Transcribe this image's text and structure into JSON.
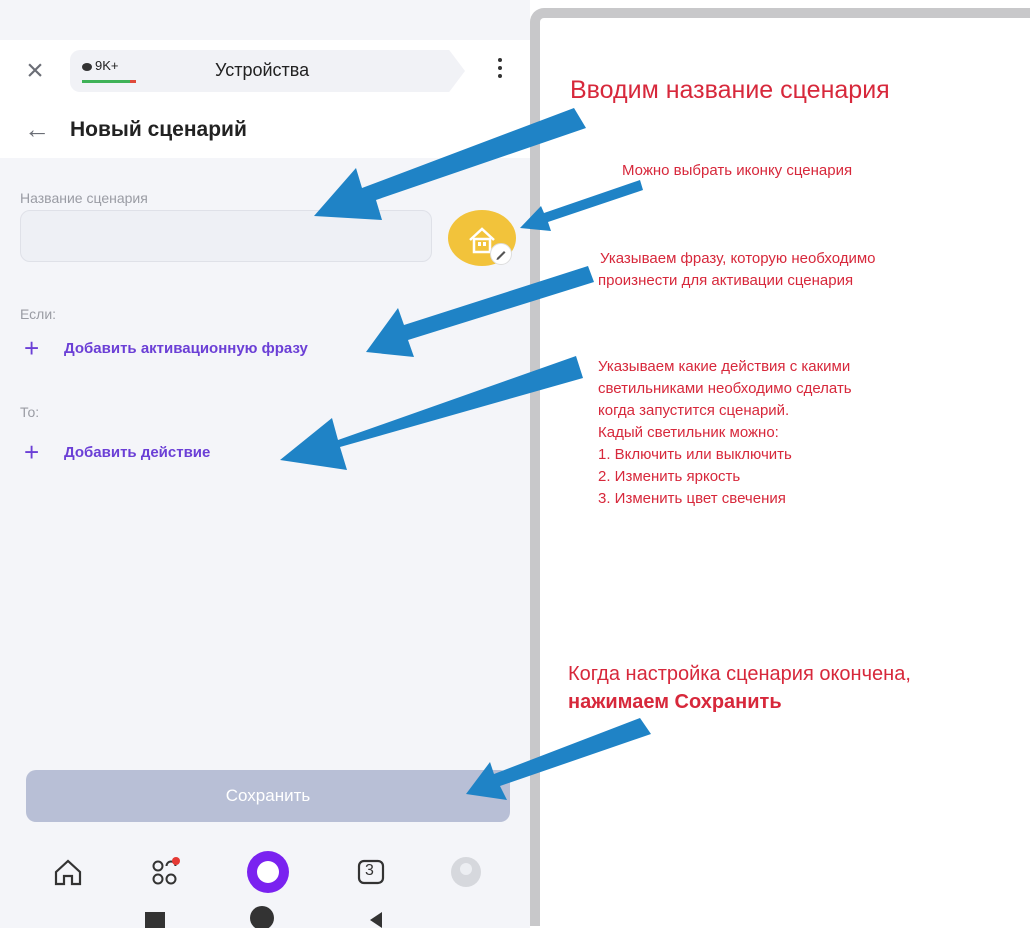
{
  "colors": {
    "accent_purple": "#6b3fd6",
    "annotation_red": "#d7283b",
    "arrow_blue": "#1f83c6",
    "save_button_disabled": "#b8bfd6",
    "icon_yellow": "#f2c33b"
  },
  "topbar": {
    "close_icon": "close-icon",
    "badge_text": "9K+",
    "tab_title": "Устройства",
    "menu_icon": "kebab-menu-icon"
  },
  "header": {
    "back_icon": "back-arrow-icon",
    "title": "Новый сценарий"
  },
  "form": {
    "name_label": "Название сценария",
    "name_value": "",
    "scenario_icon": "home-icon",
    "if_label": "Если:",
    "add_phrase_label": "Добавить активационную фразу",
    "then_label": "То:",
    "add_action_label": "Добавить действие",
    "save_label": "Сохранить"
  },
  "bottom_nav": {
    "items": [
      "home-icon",
      "apps-icon",
      "alice-icon",
      "tabs-counter-icon",
      "profile-icon"
    ],
    "tabs_count": "3"
  },
  "system_nav": [
    "recents-icon",
    "home-circle-icon",
    "back-triangle-icon"
  ],
  "annotations": {
    "enter_name": "Вводим название сценария",
    "choose_icon": "Можно выбрать иконку сценария",
    "phrase_line1": "Указываем фразу, которую необходимо",
    "phrase_line2": "произнести для активации сценария",
    "actions_line1": "Указываем какие действия с какими",
    "actions_line2": "светильниками необходимо сделать",
    "actions_line3": "когда запустится сценарий.",
    "actions_line4": "Кадый светильник можно:",
    "actions_item1": "1. Включить или выключить",
    "actions_item2": "2. Изменить яркость",
    "actions_item3": "3. Изменить цвет свечения",
    "save_line1": "Когда настройка сценария окончена,",
    "save_line2": "нажимаем Сохранить"
  }
}
